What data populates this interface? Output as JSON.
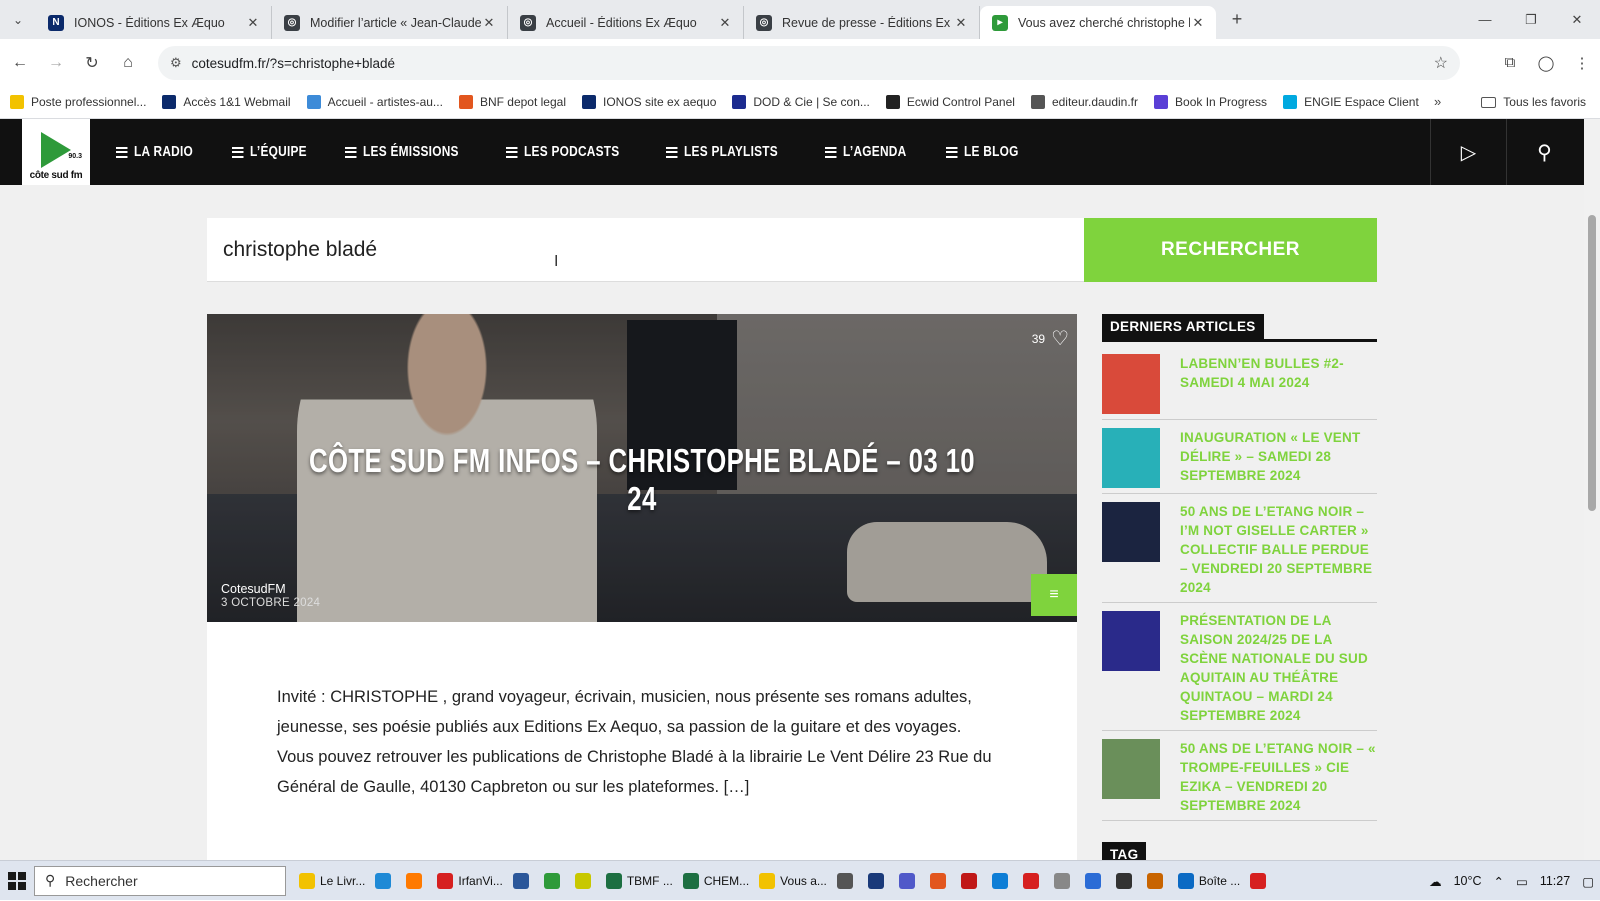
{
  "tabs": [
    {
      "title": "IONOS - Éditions Ex Æquo",
      "color": "#0b2a6b",
      "glyph": "N"
    },
    {
      "title": "Modifier l’article « Jean-Claude",
      "color": "#3a3f45",
      "glyph": "◎"
    },
    {
      "title": "Accueil - Éditions Ex Æquo",
      "color": "#3a3f45",
      "glyph": "◎"
    },
    {
      "title": "Revue de presse - Éditions Ex Æ",
      "color": "#3a3f45",
      "glyph": "◎"
    },
    {
      "title": "Vous avez cherché christophe b",
      "color": "#2e9a3a",
      "glyph": "▸"
    }
  ],
  "address": {
    "url": "cotesudfm.fr/?s=christophe+bladé"
  },
  "bookmarks": [
    {
      "label": "Poste professionnel...",
      "color": "#f2c200"
    },
    {
      "label": "Accès 1&1 Webmail",
      "color": "#0b2a6b"
    },
    {
      "label": "Accueil - artistes-au...",
      "color": "#3d8bd8"
    },
    {
      "label": "BNF depot legal",
      "color": "#e2561e"
    },
    {
      "label": "IONOS site ex aequo",
      "color": "#0b2a6b"
    },
    {
      "label": "DOD & Cie | Se con...",
      "color": "#1c2b8f"
    },
    {
      "label": "Ecwid Control Panel",
      "color": "#222222"
    },
    {
      "label": "editeur.daudin.fr",
      "color": "#555555"
    },
    {
      "label": "Book In Progress",
      "color": "#5a3fd6"
    },
    {
      "label": "ENGIE Espace Client",
      "color": "#00a9e0"
    }
  ],
  "bookmarks_folder": "Tous les favoris",
  "site": {
    "logo_text": "côte sud fm",
    "logo_freq": "90.3",
    "menu": [
      "LA RADIO",
      "L’ÉQUIPE",
      "LES ÉMISSIONS",
      "LES PODCASTS",
      "LES PLAYLISTS",
      "L’AGENDA",
      "LE BLOG"
    ]
  },
  "search": {
    "value": "christophe bladé",
    "button": "RECHERCHER"
  },
  "post": {
    "title": "CÔTE SUD FM INFOS – CHRISTOPHE BLADÉ – 03 10 24",
    "likes": "39",
    "author": "CotesudFM",
    "date": "3 OCTOBRE 2024",
    "excerpt": "Invité : CHRISTOPHE , grand voyageur, écrivain, musicien, nous présente ses romans adultes, jeunesse, ses poésie publiés aux Editions Ex Aequo, sa passion de la guitare et des voyages. Vous pouvez retrouver les publications de Christophe Bladé à la librairie Le Vent Délire 23 Rue du Général de Gaulle, 40130 Capbreton ou sur les plateformes.  […]"
  },
  "sidebar": {
    "title": "DERNIERS ARTICLES",
    "articles": [
      {
        "title": "LABENN’EN BULLES #2- SAMEDI 4 MAI 2024",
        "thumb": "#d94a3a"
      },
      {
        "title": "INAUGURATION « LE VENT DÉLIRE » – SAMEDI 28 SEPTEMBRE 2024",
        "thumb": "#28b0b8"
      },
      {
        "title": "50 ANS DE L’ETANG NOIR – I’M NOT GISELLE CARTER » COLLECTIF BALLE PERDUE – VENDREDI 20 SEPTEMBRE 2024",
        "thumb": "#1b2440"
      },
      {
        "title": "PRÉSENTATION DE LA SAISON 2024/25 DE LA SCÈNE NATIONALE DU SUD AQUITAIN AU THÉÂTRE QUINTAOU – MARDI 24 SEPTEMBRE 2024",
        "thumb": "#2a2a8a"
      },
      {
        "title": "50 ANS DE L’ETANG NOIR – « TROMPE-FEUILLES » CIE EZIKA – VENDREDI 20 SEPTEMBRE 2024",
        "thumb": "#6a8f5a"
      }
    ],
    "tag_title": "TAG"
  },
  "taskbar": {
    "search": "Rechercher",
    "apps": [
      {
        "label": "Le Livr...",
        "color": "#f2c200"
      },
      {
        "label": "",
        "color": "#1f8ad6"
      },
      {
        "label": "",
        "color": "#ff7a00"
      },
      {
        "label": "IrfanVi...",
        "color": "#d62020"
      },
      {
        "label": "",
        "color": "#2b579a"
      },
      {
        "label": "",
        "color": "#2e9a3a"
      },
      {
        "label": "",
        "color": "#c8c800"
      },
      {
        "label": "TBMF ...",
        "color": "#1d6f42"
      },
      {
        "label": "CHEM...",
        "color": "#1d6f42"
      },
      {
        "label": "Vous a...",
        "color": "#f2c200"
      },
      {
        "label": "",
        "color": "#555555"
      },
      {
        "label": "",
        "color": "#1a3a7a"
      },
      {
        "label": "",
        "color": "#5059c9"
      },
      {
        "label": "",
        "color": "#e2561e"
      },
      {
        "label": "",
        "color": "#c01818"
      },
      {
        "label": "",
        "color": "#0e7ed6"
      },
      {
        "label": "",
        "color": "#d62020"
      },
      {
        "label": "",
        "color": "#888888"
      },
      {
        "label": "",
        "color": "#2b6cd6"
      },
      {
        "label": "",
        "color": "#333333"
      },
      {
        "label": "",
        "color": "#c86400"
      },
      {
        "label": "Boîte ...",
        "color": "#0b6ac4"
      },
      {
        "label": "",
        "color": "#d62020"
      }
    ],
    "weather": "10°C",
    "time": "11:27"
  }
}
